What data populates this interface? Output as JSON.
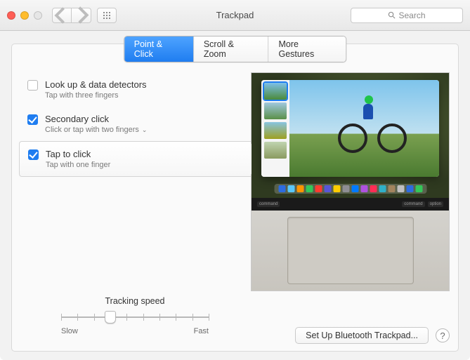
{
  "window": {
    "title": "Trackpad"
  },
  "search": {
    "placeholder": "Search"
  },
  "tabs": [
    {
      "label": "Point & Click",
      "active": true
    },
    {
      "label": "Scroll & Zoom",
      "active": false
    },
    {
      "label": "More Gestures",
      "active": false
    }
  ],
  "options": [
    {
      "title": "Look up & data detectors",
      "subtitle": "Tap with three fingers",
      "checked": false,
      "dropdown": false
    },
    {
      "title": "Secondary click",
      "subtitle": "Click or tap with two fingers",
      "checked": true,
      "dropdown": true
    },
    {
      "title": "Tap to click",
      "subtitle": "Tap with one finger",
      "checked": true,
      "dropdown": false,
      "selected": true
    }
  ],
  "slider": {
    "label": "Tracking speed",
    "ticks": 10,
    "position_index": 3,
    "low": "Slow",
    "high": "Fast"
  },
  "keyrow": {
    "left": "command",
    "right1": "command",
    "right2": "option"
  },
  "footer": {
    "bluetooth": "Set Up Bluetooth Trackpad...",
    "help": "?"
  },
  "dock_colors": [
    "#2d6cdf",
    "#5ac8fa",
    "#ff9500",
    "#34c759",
    "#ff3b30",
    "#5856d6",
    "#ffcc00",
    "#8e8e93",
    "#007aff",
    "#af52de",
    "#ff2d55",
    "#30b0c7",
    "#a2845e",
    "#c0c0c0",
    "#2d6cdf",
    "#34c759"
  ]
}
